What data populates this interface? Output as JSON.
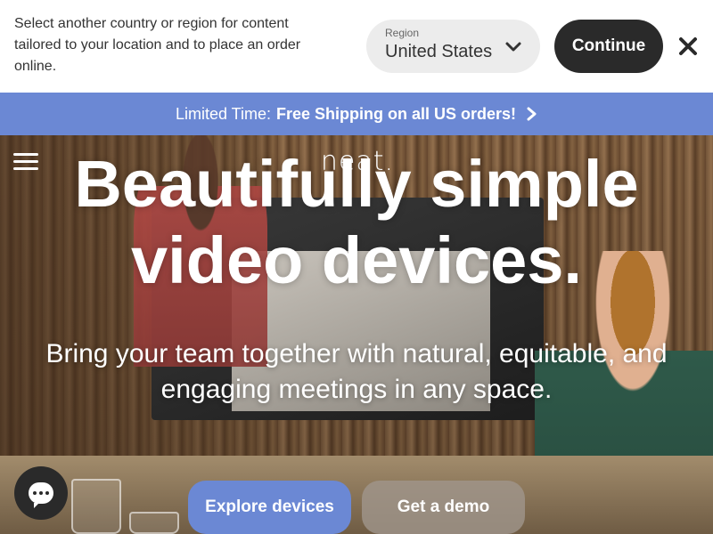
{
  "region_bar": {
    "message": "Select another country or region for content tailored to your location and to place an order online.",
    "select_label": "Region",
    "select_value": "United States",
    "continue_label": "Continue"
  },
  "promo": {
    "prefix": "Limited Time:",
    "highlight": "Free Shipping on all US orders!"
  },
  "hero": {
    "logo_text": "neat.",
    "headline_line1": "Beautifully simple",
    "headline_line2": "video devices.",
    "subheadline": "Bring your team together with natural, equitable, and engaging meetings in any space.",
    "primary_cta": "Explore devices",
    "secondary_cta": "Get a demo"
  },
  "colors": {
    "accent": "#6b88d4",
    "dark_button": "#2a2a2a",
    "select_bg": "#ececec"
  },
  "icons": {
    "chevron": "chevron-down-icon",
    "close": "close-icon",
    "promo_arrow": "chevron-right-icon",
    "menu": "hamburger-menu-icon",
    "chat": "chat-bubble-icon"
  }
}
